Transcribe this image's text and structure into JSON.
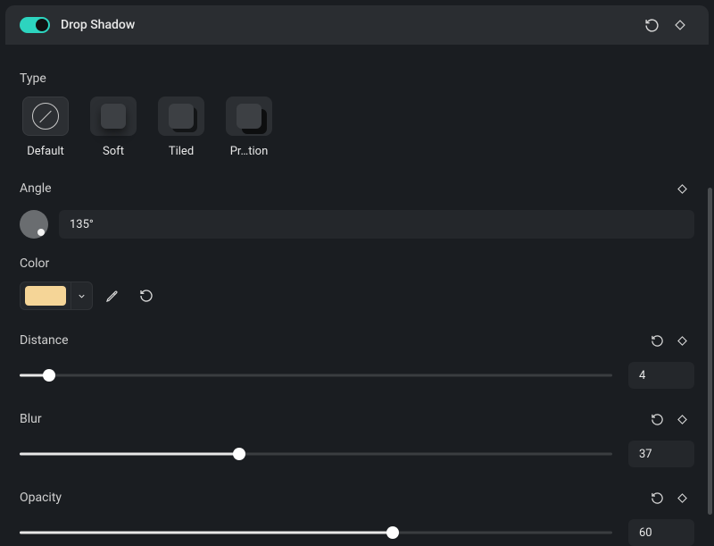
{
  "header": {
    "title": "Drop Shadow",
    "enabled": true
  },
  "type": {
    "label": "Type",
    "options": [
      {
        "label": "Default",
        "kind": "default",
        "selected": true
      },
      {
        "label": "Soft",
        "kind": "soft",
        "selected": false
      },
      {
        "label": "Tiled",
        "kind": "tiled",
        "selected": false
      },
      {
        "label": "Projection",
        "kind": "proj",
        "selected": false,
        "display": "Pr…tion"
      }
    ]
  },
  "angle": {
    "label": "Angle",
    "value": "135°"
  },
  "color": {
    "label": "Color",
    "swatch": "#f5d597"
  },
  "distance": {
    "label": "Distance",
    "value": "4",
    "percent": 5
  },
  "blur": {
    "label": "Blur",
    "value": "37",
    "percent": 37
  },
  "opacity": {
    "label": "Opacity",
    "value": "60",
    "percent": 63
  }
}
